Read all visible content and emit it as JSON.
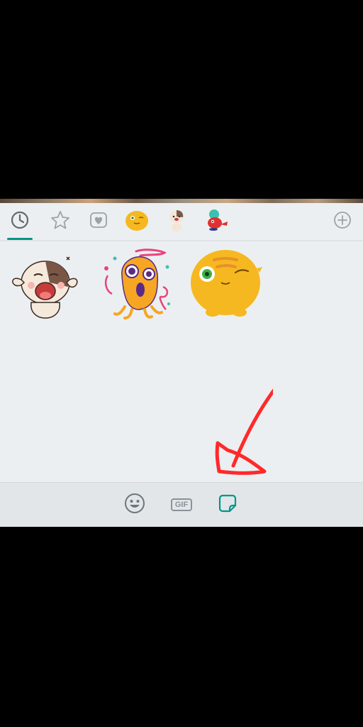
{
  "colors": {
    "accent": "#009688",
    "icon_gray": "#8a9398",
    "panel_bg": "#eceff1",
    "annotation_red": "#ff2a2a"
  },
  "tabs": [
    {
      "icon": "clock-icon",
      "name": "recent"
    },
    {
      "icon": "star-icon",
      "name": "favorites"
    },
    {
      "icon": "heart-icon",
      "name": "loved"
    },
    {
      "icon": "sticker-pack-yellow-blob",
      "name": "pack-1"
    },
    {
      "icon": "sticker-pack-dog",
      "name": "pack-2"
    },
    {
      "icon": "sticker-pack-red-creature",
      "name": "pack-3"
    }
  ],
  "bottom_bar": {
    "gif_label": "GIF"
  }
}
